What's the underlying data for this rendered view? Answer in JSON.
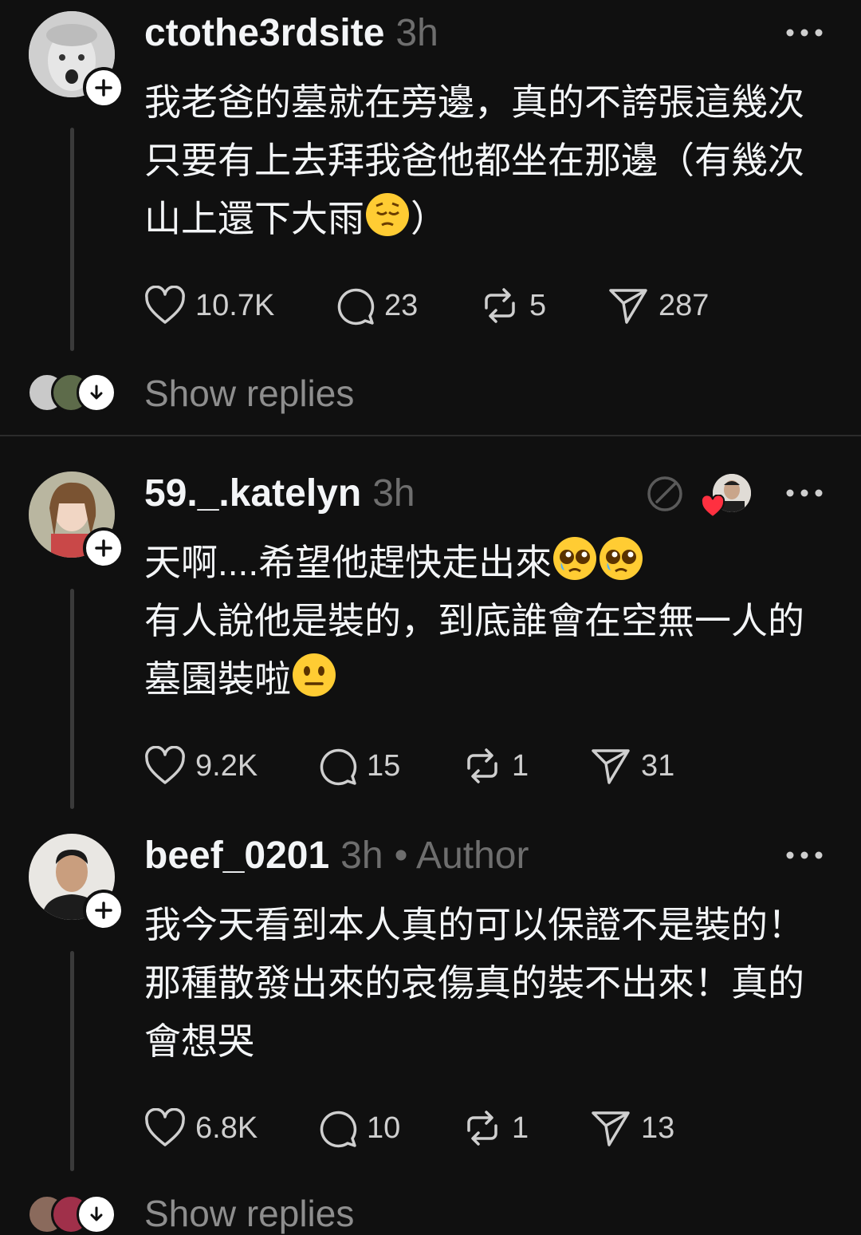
{
  "posts": [
    {
      "username": "ctothe3rdsite",
      "time": "3h",
      "lines": [
        "我老爸的墓就在旁邊，真的不誇張這幾次",
        "只要有上去拜我爸他都坐在那邊（有幾次",
        "山上還下大雨",
        "）"
      ],
      "likes": "10.7K",
      "comments": "23",
      "reposts": "5",
      "shares": "287",
      "show_replies": "Show replies"
    },
    {
      "username": "59._.katelyn",
      "time": "3h",
      "lines": [
        "天啊....希望他趕快走出來",
        "有人說他是裝的，到底誰會在空無一人的",
        "墓園裝啦"
      ],
      "likes": "9.2K",
      "comments": "15",
      "reposts": "1",
      "shares": "31"
    },
    {
      "username": "beef_0201",
      "time": "3h",
      "author_label": "• Author",
      "lines": [
        "我今天看到本人真的可以保證不是裝的！",
        "那種散發出來的哀傷真的裝不出來！真的",
        "會想哭"
      ],
      "likes": "6.8K",
      "comments": "10",
      "reposts": "1",
      "shares": "13",
      "show_replies": "Show replies"
    }
  ],
  "icons": [
    "plus-icon",
    "more-icon",
    "heart-icon",
    "comment-icon",
    "repost-icon",
    "share-icon",
    "down-arrow-icon",
    "quote-icon",
    "liked-heart-icon"
  ],
  "colors": {
    "background": "#101010",
    "text": "#f3f5f7",
    "muted": "#6e6e6e",
    "heart": "#ff3040"
  }
}
